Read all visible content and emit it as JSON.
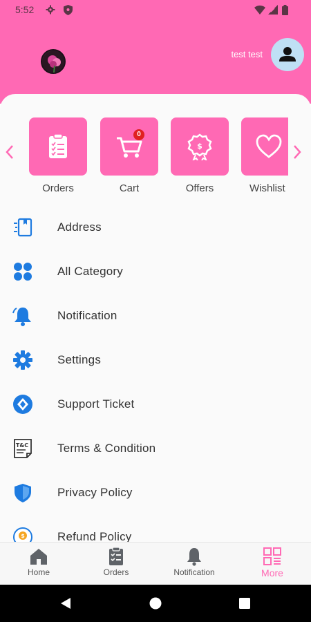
{
  "status_bar": {
    "time": "5:52"
  },
  "header": {
    "username": "test test"
  },
  "quick_actions": [
    {
      "label": "Orders",
      "icon": "clipboard-icon"
    },
    {
      "label": "Cart",
      "icon": "cart-icon",
      "badge": "0"
    },
    {
      "label": "Offers",
      "icon": "offer-badge-icon"
    },
    {
      "label": "Wishlist",
      "icon": "heart-icon"
    }
  ],
  "menu": [
    {
      "label": "Address",
      "icon": "address-book-icon"
    },
    {
      "label": "All Category",
      "icon": "grid-dots-icon"
    },
    {
      "label": "Notification",
      "icon": "bell-icon"
    },
    {
      "label": "Settings",
      "icon": "gear-icon"
    },
    {
      "label": "Support Ticket",
      "icon": "diamond-circle-icon"
    },
    {
      "label": "Terms & Condition",
      "icon": "tc-document-icon"
    },
    {
      "label": "Privacy Policy",
      "icon": "shield-icon"
    },
    {
      "label": "Refund Policy",
      "icon": "refund-icon"
    }
  ],
  "bottom_nav": [
    {
      "label": "Home",
      "icon": "home-icon"
    },
    {
      "label": "Orders",
      "icon": "clipboard-icon"
    },
    {
      "label": "Notification",
      "icon": "bell-icon"
    },
    {
      "label": "More",
      "icon": "qr-grid-icon",
      "active": true
    }
  ],
  "colors": {
    "primary": "#ff69b4",
    "icon_blue": "#1e7be0"
  }
}
